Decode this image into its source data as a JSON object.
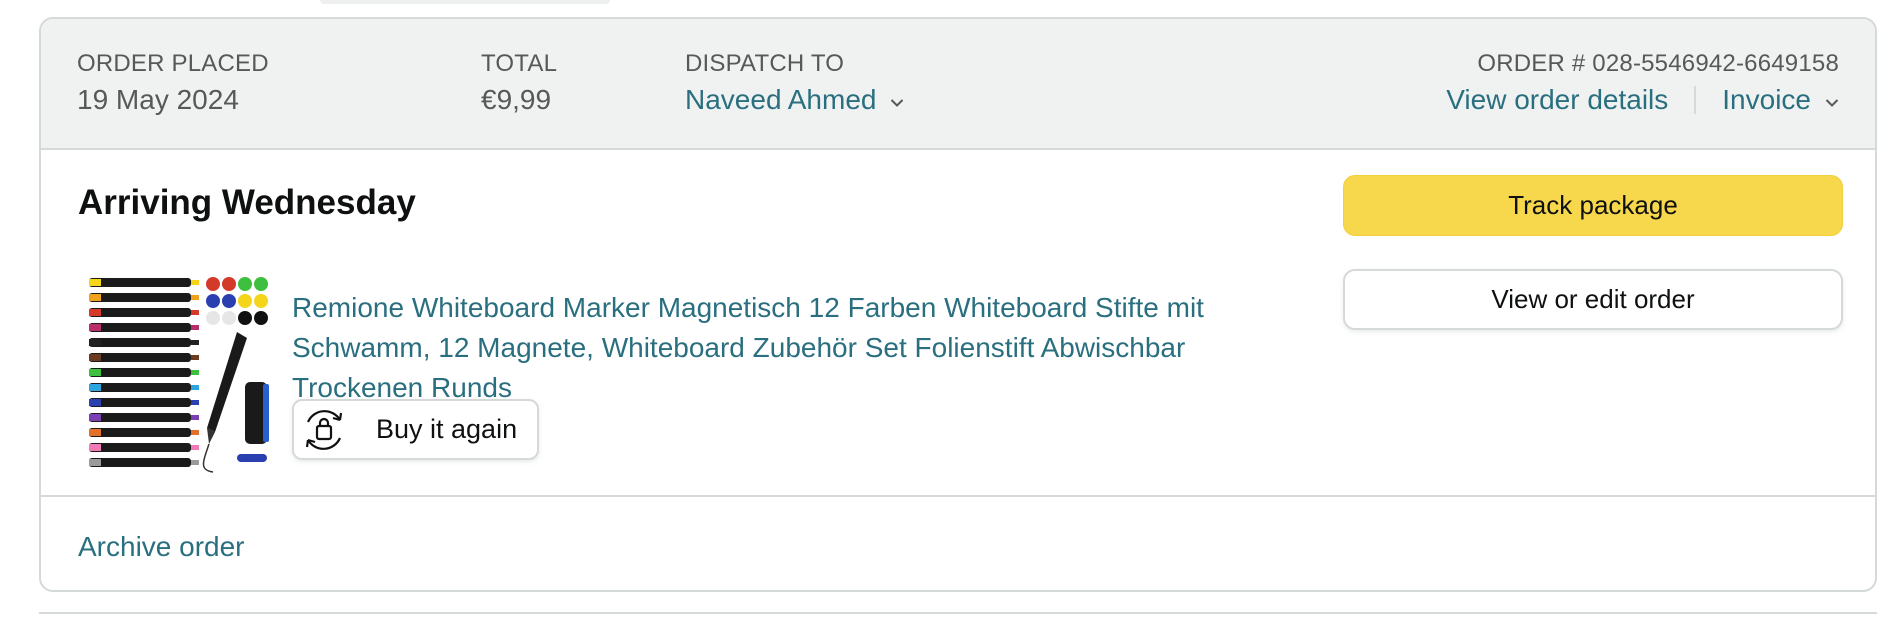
{
  "header": {
    "order_placed_label": "ORDER PLACED",
    "order_placed_value": "19 May 2024",
    "total_label": "TOTAL",
    "total_value": "€9,99",
    "dispatch_label": "DISPATCH TO",
    "dispatch_value": "Naveed Ahmed",
    "order_number_label": "ORDER # 028-5546942-6649158",
    "view_details_label": "View order details",
    "invoice_label": "Invoice"
  },
  "shipment": {
    "status": "Arriving Wednesday",
    "product_title": "Remione Whiteboard Marker Magnetisch 12 Farben Whiteboard Stifte mit Schwamm, 12 Magnete, Whiteboard Zubehör Set Folienstift Abwischbar Trockenen Runds",
    "buy_again_label": "Buy it again"
  },
  "actions": {
    "track_label": "Track package",
    "view_edit_label": "View or edit order"
  },
  "footer": {
    "archive_label": "Archive order"
  },
  "colors": {
    "link": "#2a6f7f",
    "primary_button": "#f7d74b",
    "header_bg": "#f0f2f2",
    "border": "#d5d9d9"
  },
  "icons": {
    "dispatch_chevron": "chevron-down-icon",
    "invoice_chevron": "chevron-down-icon",
    "buy_again": "reorder-bag-icon"
  }
}
